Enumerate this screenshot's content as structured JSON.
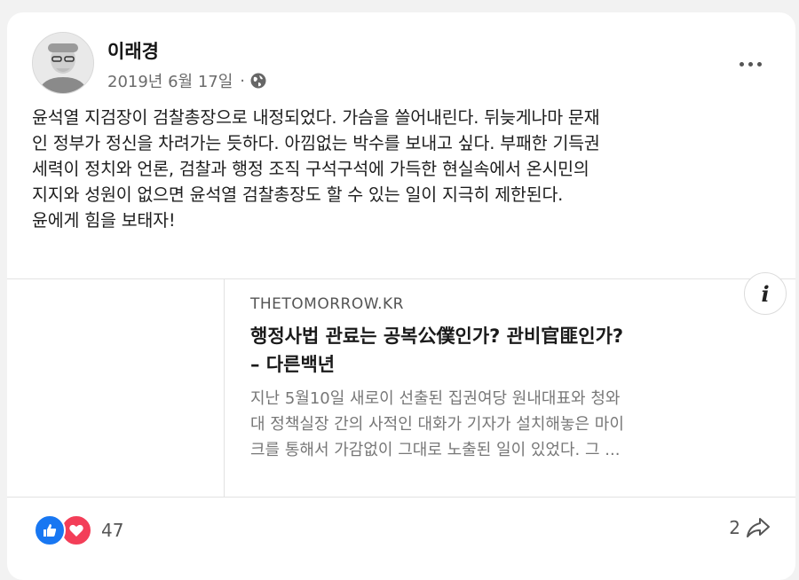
{
  "post": {
    "author": "이래경",
    "date": "2019년 6월 17일",
    "separator": "·",
    "audience_icon": "globe-icon",
    "more_icon": "more-options-icon",
    "text": "윤석열 지검장이 검찰총장으로 내정되었다. 가슴을 쓸어내린다. 뒤늦게나마 문재\n인 정부가 정신을 차려가는 듯하다. 아낌없는 박수를 보내고 싶다. 부패한 기득권\n세력이 정치와 언론, 검찰과 행정 조직  구석구석에 가득한 현실속에서 온시민의\n지지와 성원이 없으면 윤석열 검찰총장도 할 수 있는 일이 지극히 제한된다.\n윤에게 힘을 보태자!"
  },
  "link": {
    "domain": "THETOMORROW.KR",
    "title": "행정사법 관료는 공복公僕인가? 관비官匪인가?\n– 다른백년",
    "description": "지난 5월10일 새로이 선출된 집권여당 원내대표와 청와\n대 정책실장 간의 사적인 대화가 기자가 설치해놓은 마이\n크를 통해서 가감없이 그대로 노출된 일이 있었다. 그 ...",
    "info_label": "i"
  },
  "footer": {
    "reaction_count": "47",
    "share_count": "2",
    "like_color": "#1877f2",
    "love_color": "#f33e58"
  }
}
